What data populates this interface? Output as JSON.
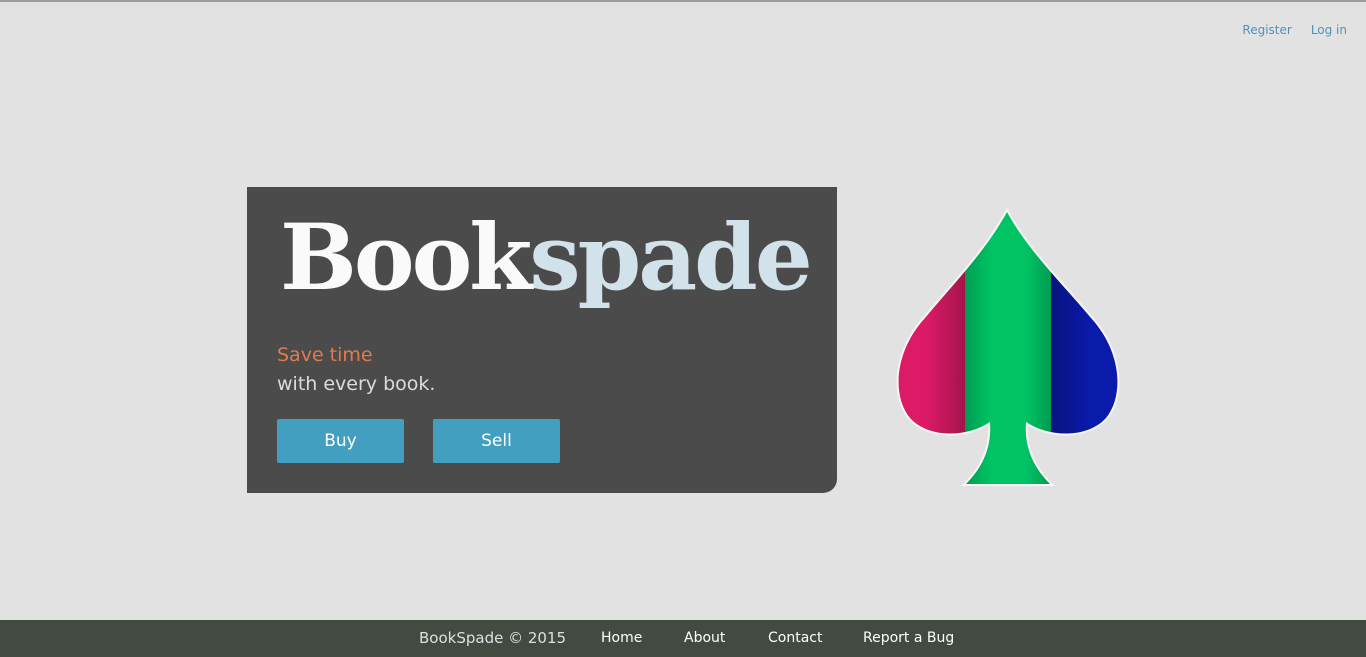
{
  "header": {
    "register_label": "Register",
    "login_label": "Log in"
  },
  "hero": {
    "brand_part1": "Book",
    "brand_part2": "spade",
    "tagline_highlight": "Save time",
    "tagline_rest": "with every book.",
    "buy_label": "Buy",
    "sell_label": "Sell"
  },
  "logo": {
    "icon": "spade-icon",
    "colors": [
      "#dc1a66",
      "#00c364",
      "#0a1aab"
    ]
  },
  "footer": {
    "copyright": "BookSpade © 2015",
    "links": [
      "Home",
      "About",
      "Contact",
      "Report a Bug"
    ]
  },
  "colors": {
    "background": "#e2e2e2",
    "hero_panel": "#4b4b4b",
    "accent_button": "#429fc0",
    "tagline_accent": "#e07b4c",
    "footer": "#434a41",
    "link": "#4f93ba"
  }
}
